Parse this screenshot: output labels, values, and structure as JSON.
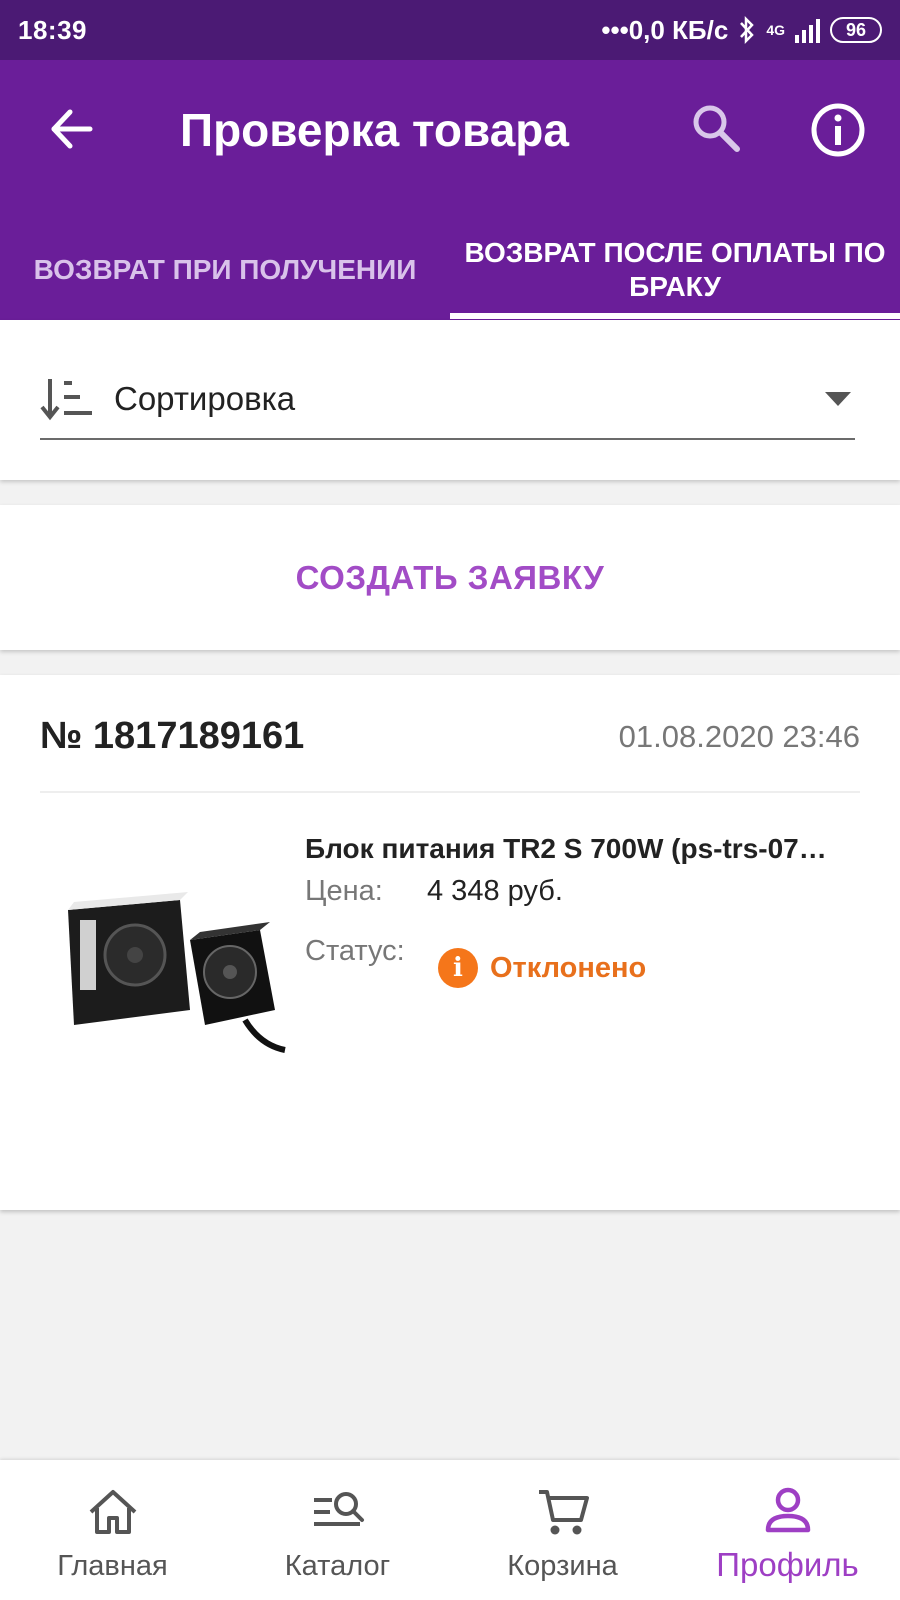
{
  "status_bar": {
    "time": "18:39",
    "network_speed": "•••0,0 КБ/с",
    "network_type": "4G",
    "battery": "96"
  },
  "app_bar": {
    "title": "Проверка товара",
    "back_icon": "arrow-back-icon",
    "search_icon": "search-icon",
    "info_icon": "info-icon"
  },
  "tabs": [
    {
      "label": "ВОЗВРАТ ПРИ ПОЛУЧЕНИИ",
      "active": false
    },
    {
      "label": "ВОЗВРАТ ПОСЛЕ ОПЛАТЫ ПО БРАКУ",
      "active": true
    }
  ],
  "sort": {
    "label": "Сортировка",
    "icon": "sort-icon"
  },
  "create_request": {
    "label": "СОЗДАТЬ ЗАЯВКУ"
  },
  "orders": [
    {
      "number": "№ 1817189161",
      "date": "01.08.2020 23:46",
      "product_name": "Блок питания TR2 S 700W (ps-trs-07…",
      "price_label": "Цена:",
      "price": "4 348 руб.",
      "status_label": "Статус:",
      "status": "Отклонено",
      "status_icon": "info-icon",
      "status_color": "#E8701C"
    }
  ],
  "bottom_nav": [
    {
      "label": "Главная",
      "icon": "home-icon",
      "active": false
    },
    {
      "label": "Каталог",
      "icon": "catalog-search-icon",
      "active": false
    },
    {
      "label": "Корзина",
      "icon": "cart-icon",
      "active": false
    },
    {
      "label": "Профиль",
      "icon": "profile-icon",
      "active": true
    }
  ],
  "colors": {
    "app_bar": "#6A1E99",
    "status_bar": "#4B1A74",
    "accent": "#A24CC6",
    "active_nav": "#9E3FC4"
  }
}
